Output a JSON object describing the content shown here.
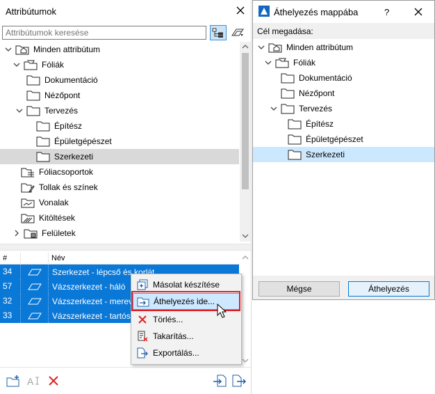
{
  "left_panel": {
    "title": "Attribútumok",
    "search_placeholder": "Attribútumok keresése",
    "tree": [
      {
        "label": "Minden attribútum"
      },
      {
        "label": "Fóliák"
      },
      {
        "label": "Dokumentáció"
      },
      {
        "label": "Nézőpont"
      },
      {
        "label": "Tervezés"
      },
      {
        "label": "Építész"
      },
      {
        "label": "Épületgépészet"
      },
      {
        "label": "Szerkezeti"
      },
      {
        "label": "Fóliacsoportok"
      },
      {
        "label": "Tollak és színek"
      },
      {
        "label": "Vonalak"
      },
      {
        "label": "Kitöltések"
      },
      {
        "label": "Felületek"
      }
    ],
    "list_header": {
      "col_num": "#",
      "col_name": "Név"
    },
    "list_rows": [
      {
        "num": "34",
        "name": "Szerkezet - lépcső és korlát"
      },
      {
        "num": "57",
        "name": "Vázszerkezet - háló"
      },
      {
        "num": "32",
        "name": "Vázszerkezet - merevítés"
      },
      {
        "num": "33",
        "name": "Vázszerkezet - tartószerkezet"
      }
    ]
  },
  "context_menu": {
    "items": [
      {
        "label": "Másolat készítése"
      },
      {
        "label": "Áthelyezés ide..."
      },
      {
        "label": "Törlés..."
      },
      {
        "label": "Takarítás..."
      },
      {
        "label": "Exportálás..."
      }
    ]
  },
  "right_dialog": {
    "title": "Áthelyezés mappába",
    "help": "?",
    "target_label": "Cél megadása:",
    "tree": [
      {
        "label": "Minden attribútum"
      },
      {
        "label": "Fóliák"
      },
      {
        "label": "Dokumentáció"
      },
      {
        "label": "Nézőpont"
      },
      {
        "label": "Tervezés"
      },
      {
        "label": "Építész"
      },
      {
        "label": "Épületgépészet"
      },
      {
        "label": "Szerkezeti"
      }
    ],
    "cancel_label": "Mégse",
    "ok_label": "Áthelyezés"
  },
  "colors": {
    "selection_blue": "#0a78d7",
    "highlight_outline": "#e11d24",
    "tree_selected_gray": "#d9d9d9",
    "dialog_selected": "#cce8ff"
  }
}
